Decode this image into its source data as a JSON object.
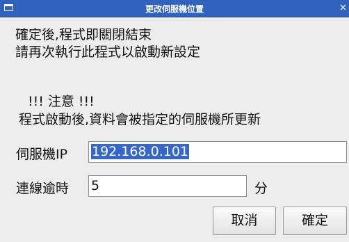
{
  "window": {
    "title": "更改伺服機位置",
    "close_glyph": "×"
  },
  "message": {
    "line1": "確定後,程式即關閉結束",
    "line2": "請再次執行此程式以啟動新設定",
    "warning_heading": "!!! 注意 !!!",
    "warning_text": "程式啟動後,資料會被指定的伺服機所更新"
  },
  "form": {
    "server_ip_label": "伺服機IP",
    "server_ip_value": "192.168.0.101",
    "timeout_label": "連線逾時",
    "timeout_value": "5",
    "timeout_unit": "分"
  },
  "buttons": {
    "cancel": "取消",
    "ok": "確定"
  }
}
